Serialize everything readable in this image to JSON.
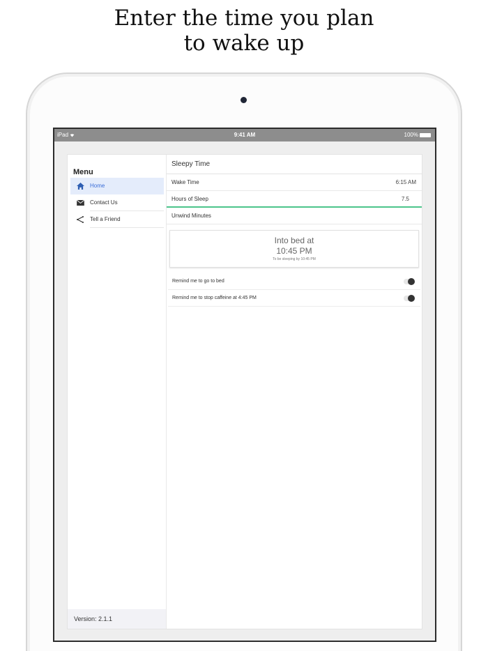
{
  "headline": {
    "line1": "Enter the time you plan",
    "line2": "to wake up"
  },
  "status_bar": {
    "device": "iPad",
    "time": "9:41 AM",
    "battery": "100%"
  },
  "sidebar": {
    "title": "Menu",
    "items": [
      {
        "label": "Home",
        "icon": "home-icon",
        "active": true
      },
      {
        "label": "Contact Us",
        "icon": "mail-icon",
        "active": false
      },
      {
        "label": "Tell a Friend",
        "icon": "share-icon",
        "active": false
      }
    ],
    "version": "Version: 2.1.1"
  },
  "main": {
    "title": "Sleepy Time",
    "fields": [
      {
        "label": "Wake Time",
        "value": "6:15 AM"
      },
      {
        "label": "Hours of Sleep",
        "value": "7.5"
      },
      {
        "label": "Unwind Minutes",
        "value": ""
      }
    ],
    "result": {
      "title": "Into bed at",
      "time": "10:45 PM",
      "subtitle": "To be sleeping by 10:45 PM"
    },
    "toggles": [
      {
        "label": "Remind me to go to bed",
        "on": false
      },
      {
        "label": "Remind me to stop caffeine at 4:45 PM",
        "on": false
      }
    ]
  },
  "colors": {
    "accent": "#3a6dd8",
    "active_bg": "#e4ecfb",
    "focus_line": "#4cc48a",
    "status_bar": "#8d8d8d"
  }
}
